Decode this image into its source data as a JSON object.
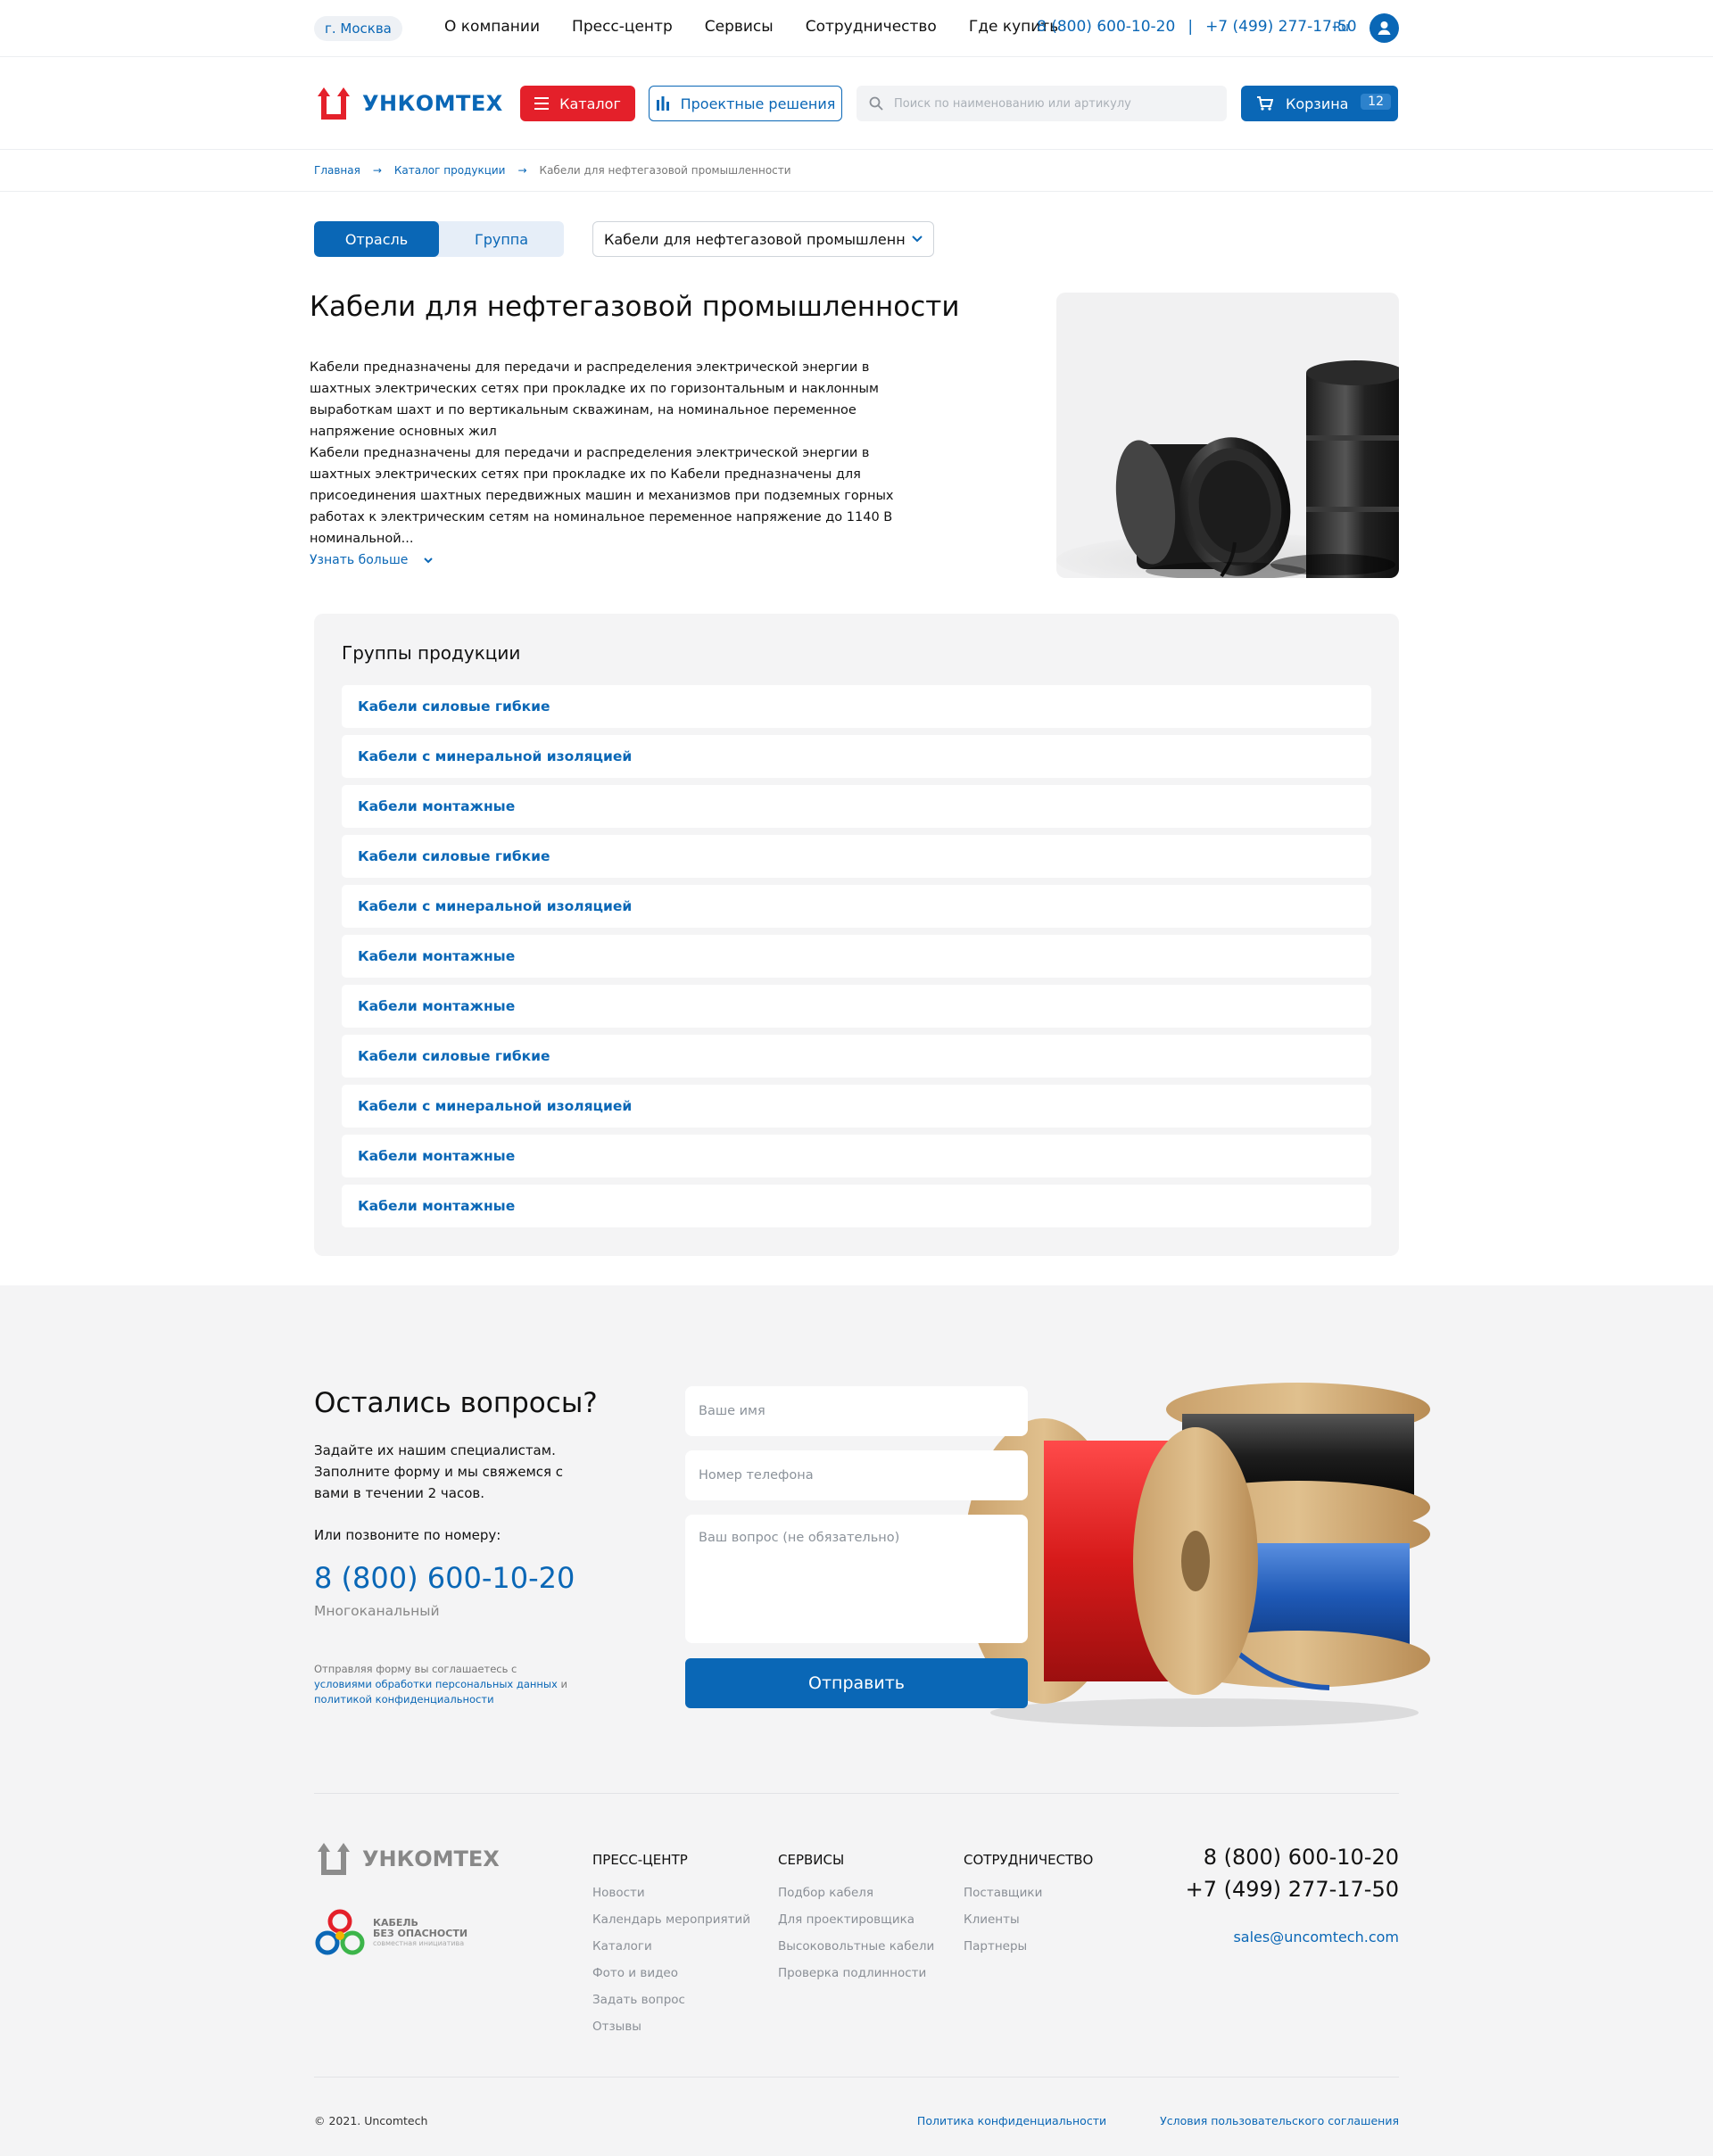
{
  "topbar": {
    "city": "г. Москва",
    "nav": [
      "О компании",
      "Пресс-центр",
      "Сервисы",
      "Сотрудничество",
      "Где купить"
    ],
    "phone1": "8 (800) 600-10-20",
    "sep": "|",
    "phone2": "+7 (499) 277-17-50",
    "lang": "Ru"
  },
  "header": {
    "logo_text": "УНКОМТЕХ",
    "catalog_label": "Каталог",
    "project_label": "Проектные решения",
    "search_placeholder": "Поиск по наименованию или артикулу",
    "cart_label": "Корзина",
    "cart_count": "12"
  },
  "breadcrumbs": [
    "Главная",
    "Каталог продукции",
    "Кабели для нефтегазовой промышленности"
  ],
  "filters": {
    "tab_industry": "Отрасль",
    "tab_group": "Группа",
    "select_value": "Кабели для нефтегазовой промышленност..."
  },
  "intro": {
    "title": "Кабели для нефтегазовой промышленности",
    "para1": "Кабели предназначены для передачи и распределения электрической энергии в шахтных электрических сетях при прокладке их по горизонтальным и наклонным выработкам шахт и по вертикальным скважинам, на номинальное переменное напряжение основных жил",
    "para2": "Кабели предназначены для передачи и распределения электрической энергии в шахтных электрических сетях при прокладке их по Кабели предназначены для присоединения шахтных передвижных машин и механизмов при подземных горных работах к электрическим сетям на номинальное переменное напряжение до 1140 В номинальной...",
    "more": "Узнать больше"
  },
  "groups": {
    "title": "Группы продукции",
    "items": [
      "Кабели силовые гибкие",
      "Кабели с минеральной изоляцией",
      "Кабели монтажные",
      "Кабели силовые гибкие",
      "Кабели с минеральной изоляцией",
      "Кабели монтажные",
      "Кабели монтажные",
      "Кабели силовые гибкие",
      "Кабели с минеральной изоляцией",
      "Кабели монтажные",
      "Кабели монтажные"
    ]
  },
  "contact": {
    "title": "Остались вопросы?",
    "text": "Задайте их нашим специалистам. Заполните форму и мы свяжемся с вами в течении 2 часов.",
    "call": "Или позвоните по номеру:",
    "phone": "8 (800) 600-10-20",
    "multichannel": "Многоканальный",
    "note_prefix": "Отправляя форму вы соглашаетесь с ",
    "note_link1": "условиями обработки персональных данных",
    "note_and": " и ",
    "note_link2": "политикой конфиденциальности",
    "name_placeholder": "Ваше имя",
    "phone_placeholder": "Номер телефона",
    "question_placeholder": "Ваш вопрос (не обязательно)",
    "submit": "Отправить"
  },
  "footer": {
    "logo_text": "УНКОМТЕХ",
    "kbo_title1": "КАБЕЛЬ",
    "kbo_title2": "БЕЗ ОПАСНОСТИ",
    "kbo_sub": "совместная инициатива",
    "col1": {
      "title": "Пресс-центр",
      "items": [
        "Новости",
        "Календарь мероприятий",
        "Каталоги",
        "Фото и видео",
        "Задать вопрос",
        "Отзывы"
      ]
    },
    "col2": {
      "title": "Сервисы",
      "items": [
        "Подбор кабеля",
        "Для проектировщика",
        "Высоковольтные кабели",
        "Проверка подлинности"
      ]
    },
    "col3": {
      "title": "Сотрудничество",
      "items": [
        "Поставщики",
        "Клиенты",
        "Партнеры"
      ]
    },
    "phone1": "8 (800) 600-10-20",
    "phone2": "+7 (499) 277-17-50",
    "email": "sales@uncomtech.com",
    "copyright": "© 2021. Uncomtech",
    "privacy": "Политика конфиденциальности",
    "terms": "Условия пользовательского соглашения"
  },
  "colors": {
    "brand_blue": "#0a67b6",
    "brand_red": "#e4202a",
    "bg_gray": "#f4f4f5"
  }
}
